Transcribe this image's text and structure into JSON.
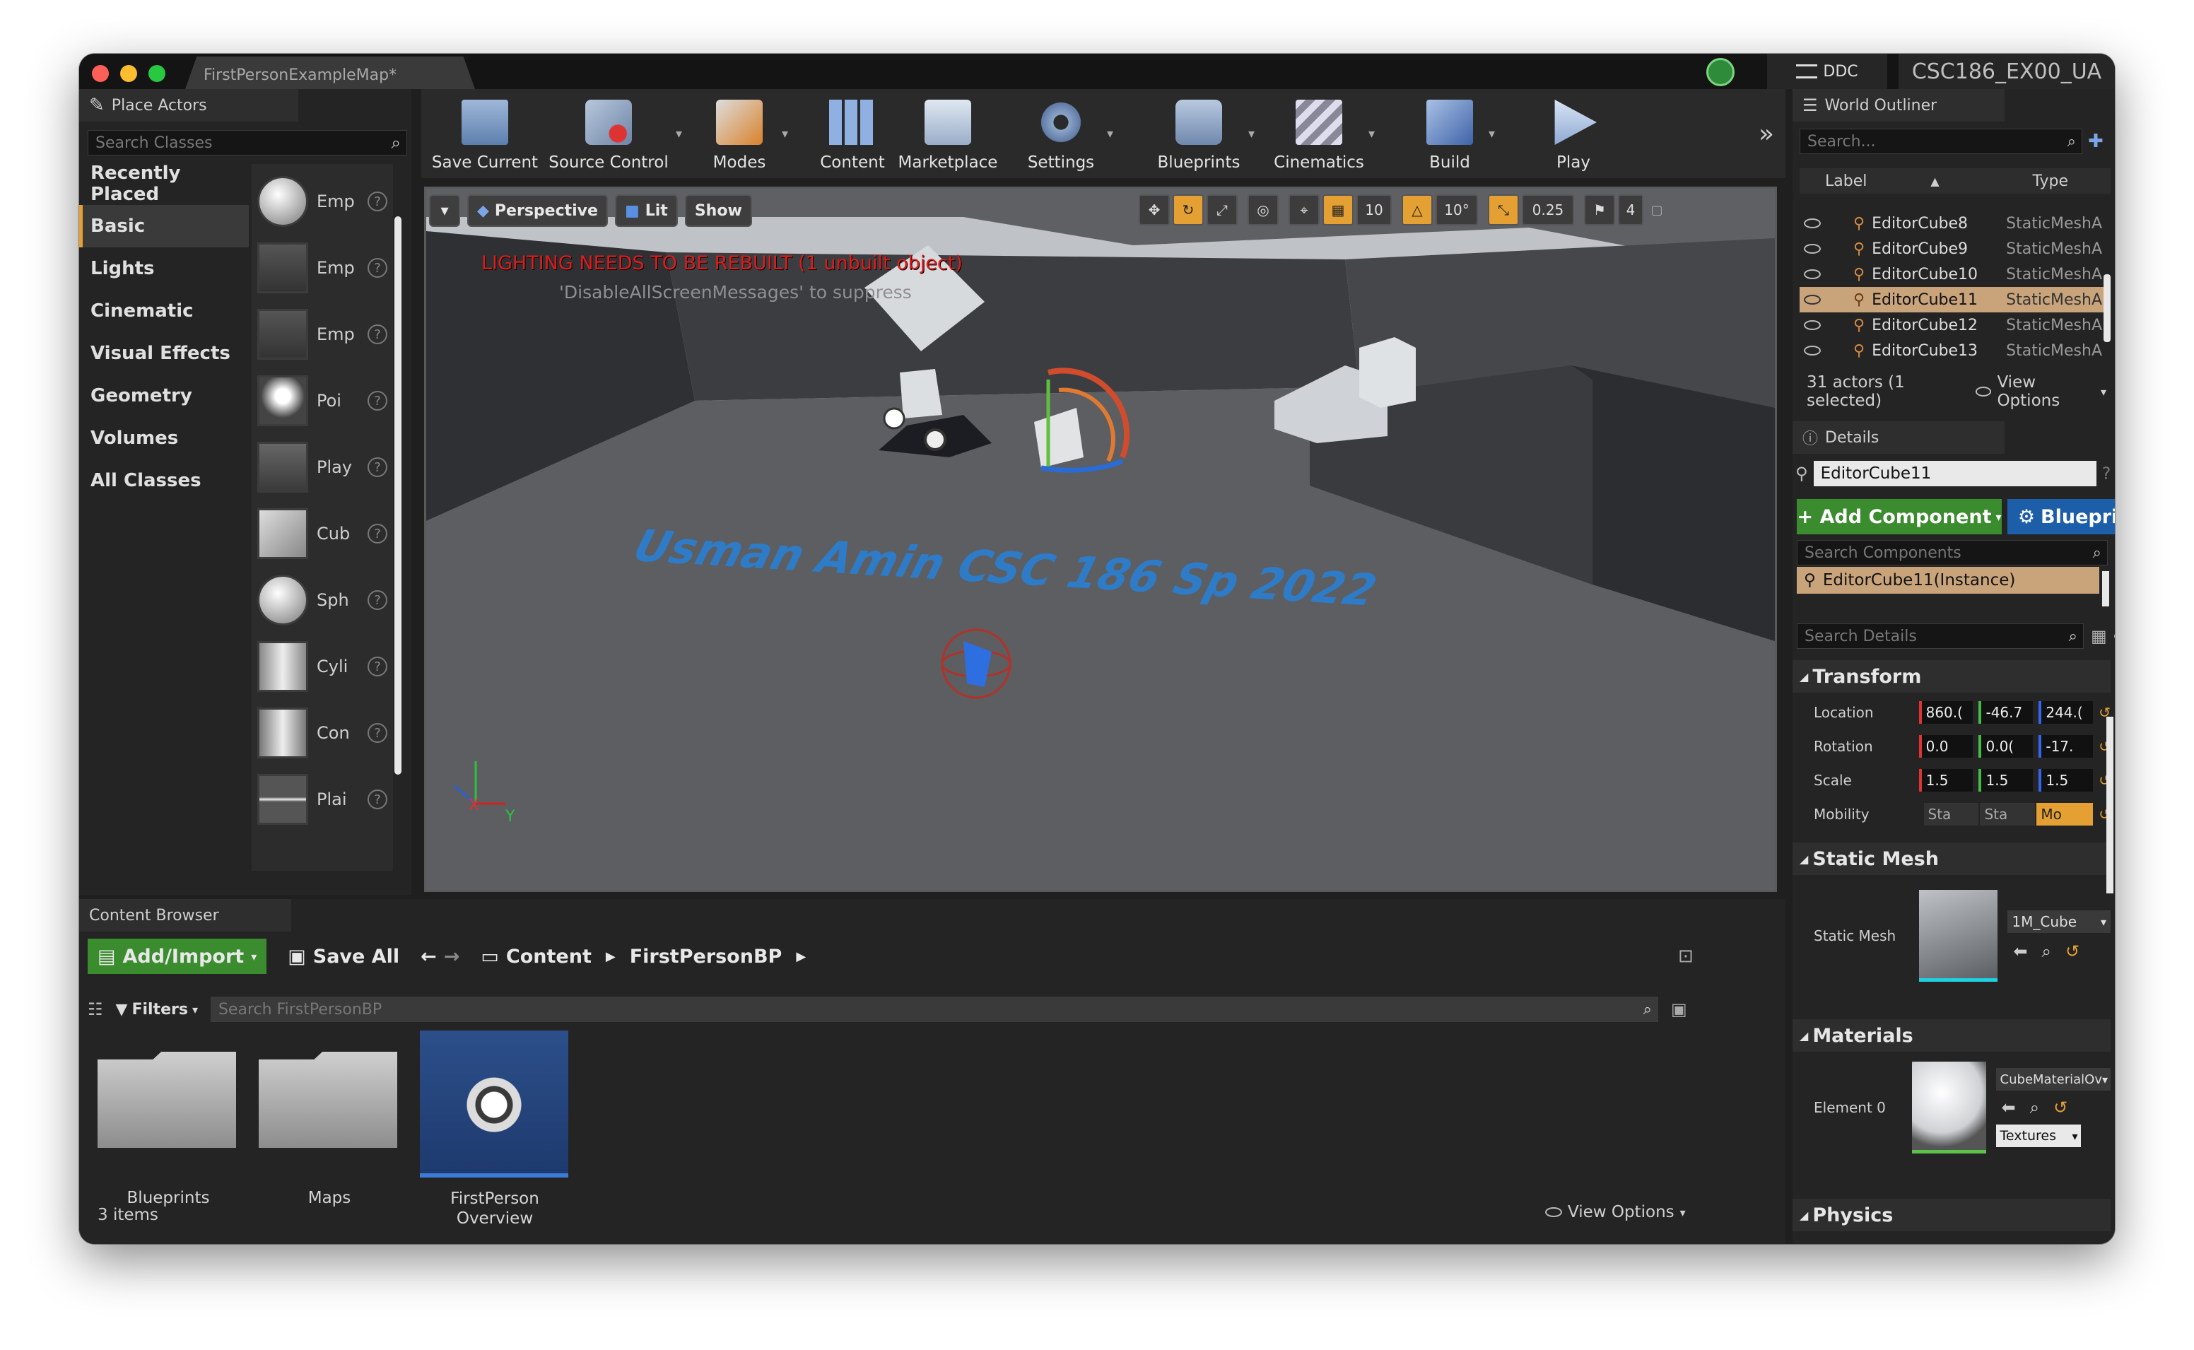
{
  "window": {
    "document_tab": "FirstPersonExampleMap*",
    "ddc_label": "DDC",
    "project_name": "CSC186_EX00_UA"
  },
  "place_actors": {
    "tab_label": "Place Actors",
    "search_placeholder": "Search Classes",
    "categories": [
      "Recently Placed",
      "Basic",
      "Lights",
      "Cinematic",
      "Visual Effects",
      "Geometry",
      "Volumes",
      "All Classes"
    ],
    "selected_category": "Basic",
    "items": [
      "Emp",
      "Emp",
      "Emp",
      "Poi",
      "Play",
      "Cub",
      "Sph",
      "Cyli",
      "Con",
      "Plai"
    ]
  },
  "toolbar": {
    "items": [
      "Save Current",
      "Source Control",
      "Modes",
      "Content",
      "Marketplace",
      "Settings",
      "Blueprints",
      "Cinematics",
      "Build",
      "Play"
    ]
  },
  "viewport": {
    "perspective_label": "Perspective",
    "lit_label": "Lit",
    "show_label": "Show",
    "grid_snap": "10",
    "rotation_snap": "10°",
    "scale_snap": "0.25",
    "camera_speed": "4",
    "warning_text": "LIGHTING NEEDS TO BE REBUILT (1 unbuilt object)",
    "suppress_text": "'DisableAllScreenMessages' to suppress",
    "floor_text": "Usman Amin CSC 186 Sp 2022",
    "axis_x": "X",
    "axis_y": "Y"
  },
  "world_outliner": {
    "tab_label": "World Outliner",
    "search_placeholder": "Search...",
    "col_label": "Label",
    "col_type": "Type",
    "rows": [
      {
        "label": "EditorCube8",
        "type": "StaticMeshA"
      },
      {
        "label": "EditorCube9",
        "type": "StaticMeshA"
      },
      {
        "label": "EditorCube10",
        "type": "StaticMeshA"
      },
      {
        "label": "EditorCube11",
        "type": "StaticMeshA"
      },
      {
        "label": "EditorCube12",
        "type": "StaticMeshA"
      },
      {
        "label": "EditorCube13",
        "type": "StaticMeshA"
      }
    ],
    "selected_row": "EditorCube11",
    "status": "31 actors (1 selected)",
    "view_options": "View Options"
  },
  "details": {
    "tab_label": "Details",
    "actor_name": "EditorCube11",
    "add_component": "+ Add Component",
    "blueprint": "Blueprint/Ac",
    "search_components_placeholder": "Search Components",
    "component_instance": "EditorCube11(Instance)",
    "search_details_placeholder": "Search Details",
    "transform_label": "Transform",
    "location_label": "Location",
    "location": [
      "860.(",
      "-46.7",
      "244.("
    ],
    "rotation_label": "Rotation",
    "rotation": [
      "0.0",
      "0.0(",
      "-17."
    ],
    "scale_label": "Scale",
    "scale": [
      "1.5",
      "1.5",
      "1.5"
    ],
    "mobility_label": "Mobility",
    "mobility": [
      "Sta",
      "Sta",
      "Mo"
    ],
    "static_mesh_section": "Static Mesh",
    "static_mesh_label": "Static Mesh",
    "static_mesh_value": "1M_Cube",
    "materials_section": "Materials",
    "element0_label": "Element 0",
    "material_value": "CubeMaterialOv",
    "textures_label": "Textures",
    "physics_section": "Physics"
  },
  "content_browser": {
    "tab_label": "Content Browser",
    "add_import": "Add/Import",
    "save_all": "Save All",
    "path": [
      "Content",
      "FirstPersonBP"
    ],
    "filters": "Filters",
    "search_placeholder": "Search FirstPersonBP",
    "assets": [
      {
        "name": "Blueprints"
      },
      {
        "name": "Maps"
      },
      {
        "name": "FirstPerson\nOverview"
      }
    ],
    "item_count": "3 items",
    "view_options": "View Options"
  },
  "colors": {
    "accent_orange": "#e5a033",
    "selection_tan": "#c9a47b",
    "warning_red": "#e01b1b",
    "green_button": "#3b8c2e",
    "blue_button": "#1c5ea8"
  }
}
